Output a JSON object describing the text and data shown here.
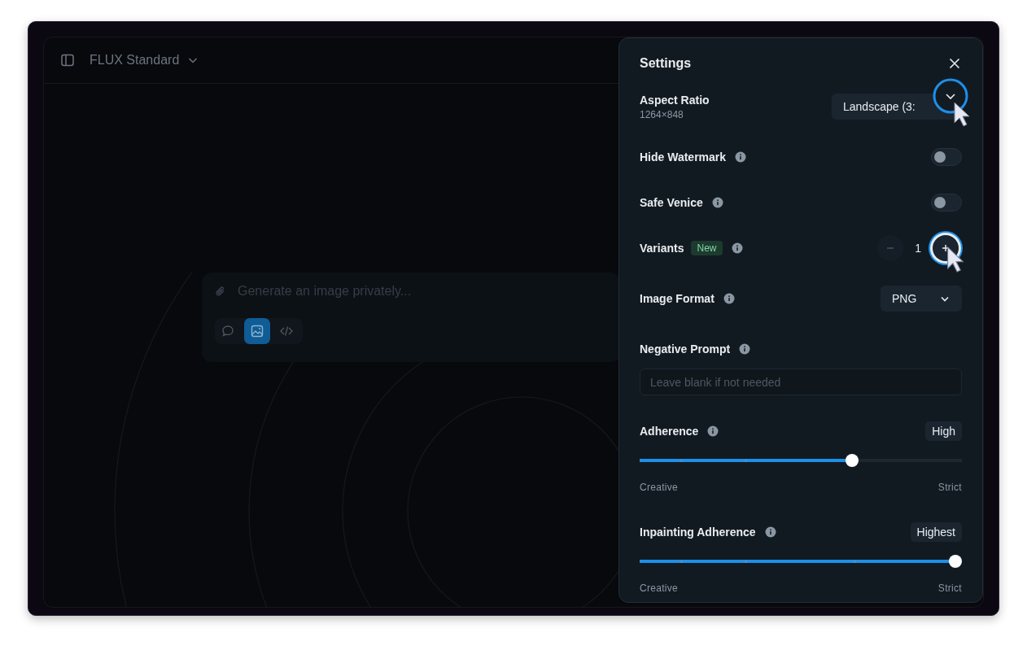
{
  "header": {
    "model": "FLUX Standard"
  },
  "composer": {
    "placeholder": "Generate an image privately...",
    "modes": [
      {
        "kind": "chat",
        "selected": false
      },
      {
        "kind": "image",
        "selected": true
      },
      {
        "kind": "code",
        "selected": false
      }
    ]
  },
  "settings": {
    "title": "Settings",
    "rows": [
      {
        "kind": "select",
        "label": "Aspect Ratio",
        "sub": "1264×848",
        "info": false,
        "value": "Landscape (3:",
        "cursor": true
      },
      {
        "kind": "toggle",
        "label": "Hide Watermark",
        "info": true,
        "on": false
      },
      {
        "kind": "toggle",
        "label": "Safe Venice",
        "info": true,
        "on": false
      },
      {
        "kind": "stepper",
        "label": "Variants",
        "badge": "New",
        "info": true,
        "value": "1",
        "cursor": true
      },
      {
        "kind": "select",
        "label": "Image Format",
        "info": true,
        "value": "PNG",
        "cursor": false
      },
      {
        "kind": "text",
        "label": "Negative Prompt",
        "info": true,
        "placeholder": "Leave blank if not needed"
      },
      {
        "kind": "slider",
        "label": "Adherence",
        "info": true,
        "value": "High",
        "level": 0.667,
        "min_label": "Creative",
        "max_label": "Strict"
      },
      {
        "kind": "slider",
        "label": "Inpainting Adherence",
        "info": true,
        "value": "Highest",
        "level": 1,
        "min_label": "Creative",
        "max_label": "Strict"
      }
    ]
  }
}
